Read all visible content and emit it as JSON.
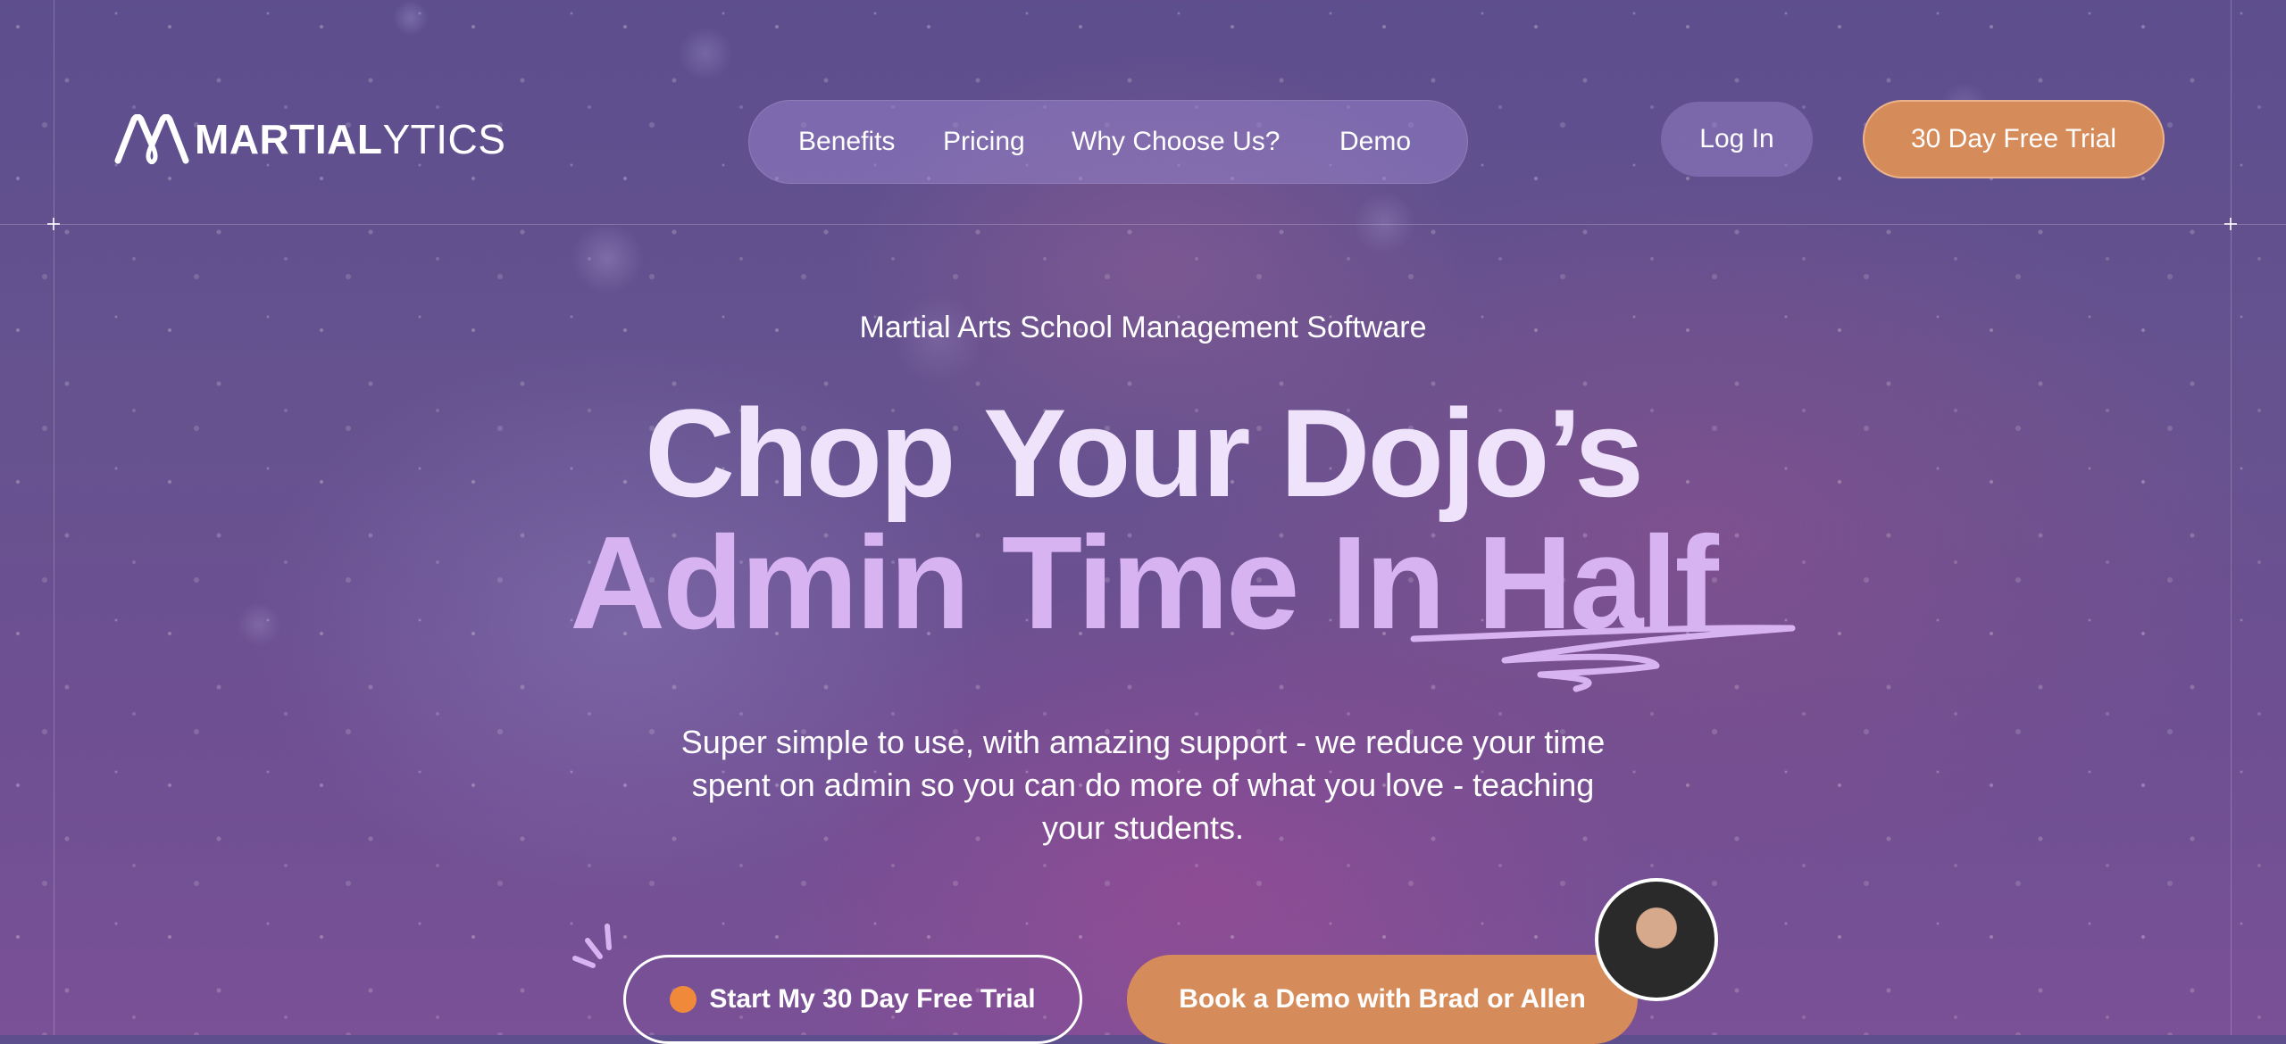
{
  "brand": {
    "logo_bold": "MARTIAL",
    "logo_light": "YTICS"
  },
  "nav": {
    "items": [
      "Benefits",
      "Pricing",
      "Why Choose Us?",
      "Demo"
    ]
  },
  "header": {
    "login_label": "Log In",
    "trial_label": "30 Day Free Trial"
  },
  "hero": {
    "eyebrow": "Martial Arts School Management Software",
    "headline_line1": "Chop Your Dojo’s",
    "headline_line2": "Admin Time In Half",
    "subheading": "Super simple to use, with amazing support - we reduce your time spent on admin so you can do more of what you love - teaching your students.",
    "primary_cta": "Start My 30 Day Free Trial",
    "secondary_cta": "Book a Demo with Brad or Allen"
  },
  "colors": {
    "accent_orange": "#d68c5a",
    "cta_dot": "#f08a3a",
    "headline_light": "#efe3fb",
    "headline_lavender": "#d8b3f2",
    "background": "#5d4e8e"
  },
  "icons": {
    "logo_mark": "m-rope-logo-icon",
    "sparkle": "sparkle-lines-icon",
    "swoosh": "underline-swoosh-icon",
    "avatar": "presenter-avatar"
  }
}
